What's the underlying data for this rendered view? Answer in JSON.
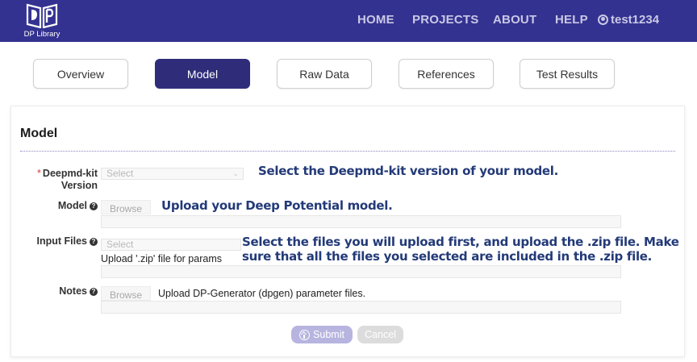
{
  "header": {
    "logo_text": "DP Library",
    "nav": [
      "HOME",
      "PROJECTS",
      "ABOUT",
      "HELP"
    ],
    "username": "test1234",
    "background_color": "#343290"
  },
  "tabs": [
    {
      "label": "Overview",
      "active": false
    },
    {
      "label": "Model",
      "active": true
    },
    {
      "label": "Raw Data",
      "active": false
    },
    {
      "label": "References",
      "active": false
    },
    {
      "label": "Test Results",
      "active": false
    }
  ],
  "form": {
    "title": "Model",
    "version": {
      "label_line1": "Deepmd-kit",
      "label_line2": "Version",
      "required_mark": "*",
      "placeholder": "Select",
      "hint": "Select the Deepmd-kit version of your model."
    },
    "model": {
      "label": "Model",
      "help_mark": "?",
      "browse_label": "Browse",
      "hint": "Upload your Deep Potential model."
    },
    "input_files": {
      "label": "Input Files",
      "help_mark": "?",
      "placeholder": "Select",
      "sub_note": "Upload '.zip' file for params",
      "hint_line1": "Select the files you will upload first, and upload the .zip file. Make",
      "hint_line2": "sure that all the files you selected are included in the .zip file."
    },
    "notes": {
      "label": "Notes",
      "help_mark": "?",
      "browse_label": "Browse",
      "note": "Upload DP-Generator (dpgen) parameter files."
    },
    "submit_label": "Submit",
    "cancel_label": "Cancel"
  }
}
